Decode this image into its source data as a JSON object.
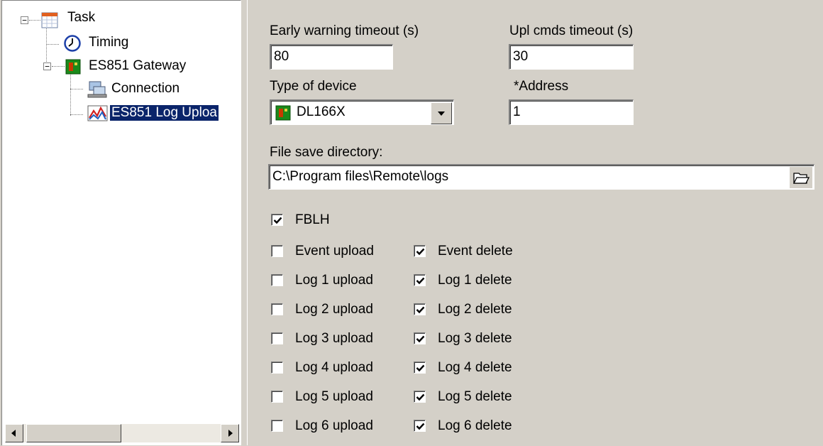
{
  "tree": {
    "nodes": [
      {
        "label": "Task",
        "icon": "calendar-icon",
        "expander": "⊟"
      },
      {
        "label": "Timing",
        "icon": "clock-icon"
      },
      {
        "label": "ES851 Gateway",
        "icon": "device-icon",
        "expander": "⊟"
      },
      {
        "label": "Connection",
        "icon": "network-icon"
      },
      {
        "label": "ES851 Log Uploa",
        "icon": "log-upload-icon",
        "selected": true
      }
    ]
  },
  "form": {
    "early_warning_label": "Early warning timeout (s)",
    "early_warning_value": "80",
    "upl_cmds_label": "Upl cmds timeout (s)",
    "upl_cmds_value": "30",
    "device_type_label": "Type of device",
    "device_type_value": "DL166X",
    "address_label": "*Address",
    "address_value": "1",
    "save_dir_label": "File save directory:",
    "save_dir_value": "C:\\Program files\\Remote\\logs",
    "fblh_label": "FBLH",
    "fblh_checked": true,
    "upload_options": [
      {
        "label": "Event upload",
        "checked": false
      },
      {
        "label": "Log 1 upload",
        "checked": false
      },
      {
        "label": "Log 2 upload",
        "checked": false
      },
      {
        "label": "Log 3 upload",
        "checked": false
      },
      {
        "label": "Log 4 upload",
        "checked": false
      },
      {
        "label": "Log 5 upload",
        "checked": false
      },
      {
        "label": "Log 6 upload",
        "checked": false
      }
    ],
    "delete_options": [
      {
        "label": "Event delete",
        "checked": true
      },
      {
        "label": "Log 1 delete",
        "checked": true
      },
      {
        "label": "Log 2 delete",
        "checked": true
      },
      {
        "label": "Log 3 delete",
        "checked": true
      },
      {
        "label": "Log 4 delete",
        "checked": true
      },
      {
        "label": "Log 5 delete",
        "checked": true
      },
      {
        "label": "Log 6 delete",
        "checked": true
      }
    ]
  },
  "colors": {
    "selection": "#0a246a",
    "face": "#d4d0c8",
    "device_green": "#1a8a1a",
    "clock_blue": "#1c3fa8"
  }
}
